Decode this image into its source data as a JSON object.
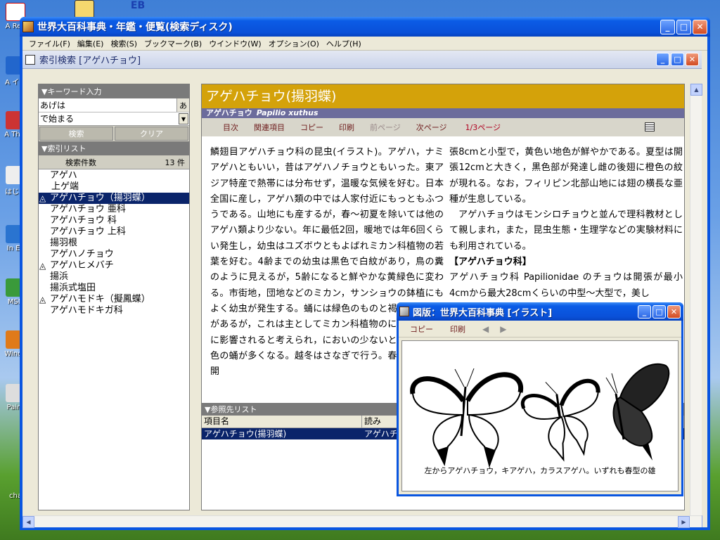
{
  "desktop": {
    "icons": [
      "A\nRea",
      "A\nイン",
      "A\nThin",
      "はじめ",
      "In\nEx",
      "MSN",
      "Windo",
      "Paint",
      "cha"
    ],
    "top_icon_label": "EB"
  },
  "window": {
    "title": "世界大百科事典・年鑑・便覧(検索ディスク)",
    "menu": [
      "ファイル(F)",
      "編集(E)",
      "検索(S)",
      "ブックマーク(B)",
      "ウインドウ(W)",
      "オプション(O)",
      "ヘルプ(H)"
    ]
  },
  "child": {
    "title": "索引検索 [アゲハチョウ]"
  },
  "keyword": {
    "section": "▼キーワード入力",
    "value": "あげは",
    "mode_btn": "あ",
    "match_mode": "で始まる",
    "search_btn": "検索",
    "clear_btn": "クリア"
  },
  "index": {
    "section": "▼索引リスト",
    "count_label": "検索件数",
    "count_value": "13 件",
    "items": [
      "アゲハ",
      "上ゲ端",
      "アゲハチョウ（揚羽蝶）",
      "アゲハチョウ 亜科",
      "アゲハチョウ 科",
      "アゲハチョウ 上科",
      "揚羽根",
      "アゲハノチョウ",
      "アゲハヒメバチ",
      "揚浜",
      "揚浜式塩田",
      "アゲハモドキ（擬鳳蝶）",
      "アゲハモドキガ科"
    ]
  },
  "article": {
    "title": "アゲハチョウ(揚羽蝶)",
    "subtitle": "アゲハチョウ",
    "latin": "Papilio xuthus",
    "toolbar": [
      "目次",
      "関連項目",
      "コピー",
      "印刷",
      "前ページ",
      "次ページ"
    ],
    "page_indicator": "1/3ページ",
    "col1": "鱗翅目アゲハチョウ科の昆虫(イラスト)。アゲハ，ナミアゲハともいい，昔はアゲハノチョウともいった。東アジア特産で熱帯には分布せず，温暖な気候を好む。日本全国に産し，アゲハ類の中では人家付近にもっともふつうである。山地にも産するが，春～初夏を除いては他のアゲハ類より少ない。年に最低2回，暖地では年6回くらい発生し，幼虫はユズボウともよばれミカン科植物の若葉を好む。4齢までの幼虫は黒色で白紋があり，鳥の糞のように見えるが，5齢になると鮮やかな黄緑色に変わる。市街地，団地などのミカン，サンショウの鉢植にもよく幼虫が発生する。蛹には緑色のものと褐色のものとがあるが，これは主としてミカン科植物のにおいの有無に影響されると考えられ，においの少ないところほど褐色の蛹が多くなる。越冬はさなぎで行う。春型の成虫は開",
    "col2a": "張8cmと小型で，黄色い地色が鮮やかである。夏型は開張12cmと大きく，黒色部が発達し雌の後翅に橙色の紋が現れる。なお，フィリピン北部山地には翅の横長な亜種が生息している。",
    "col2b": "アゲハチョウはモンシロチョウと並んで理科教材として親しまれ，また，昆虫生態・生理学などの実験材料にも利用されている。",
    "col2_heading": "【アゲハチョウ科】",
    "col2c": "アゲハチョウ科 Papilionidae のチョウは開張が最小4cmから最大28cmくらいの中型～大型で，美し"
  },
  "refs": {
    "section": "▼参照先リスト",
    "headers": [
      "項目名",
      "読み"
    ],
    "rows": [
      [
        "アゲハチョウ(揚羽蝶)",
        "アゲハチ"
      ]
    ]
  },
  "illustration": {
    "title": "図版：世界大百科事典 [イラスト]",
    "toolbar": [
      "コピー",
      "印刷"
    ],
    "prev": "◀",
    "next": "▶",
    "caption": "左からアゲハチョウ，キアゲハ，カラスアゲハ。いずれも春型の雄"
  },
  "colors": {
    "title_accent": "#d4a20a",
    "subtitle_bar": "#6c6c9c",
    "selection": "#0a246a"
  }
}
